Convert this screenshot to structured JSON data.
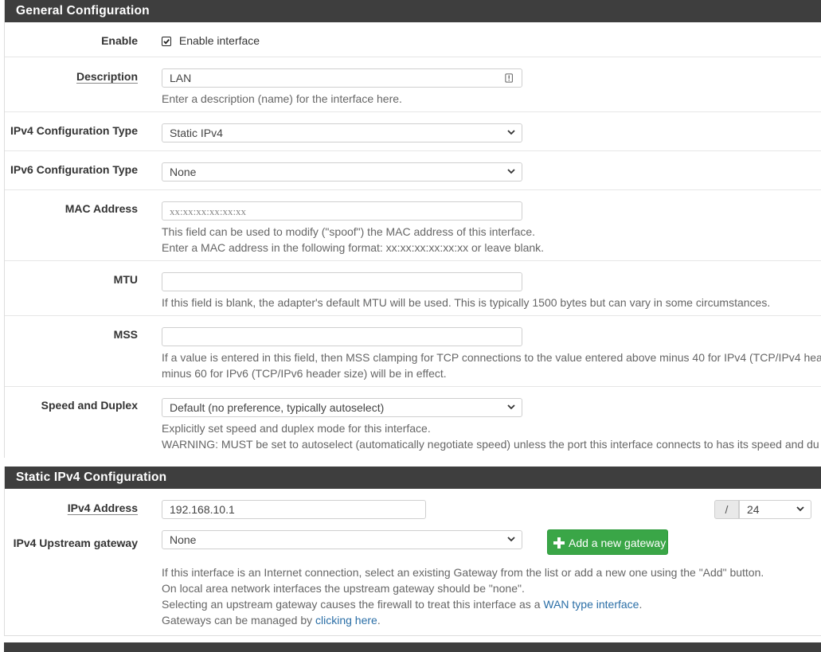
{
  "general": {
    "title": "General Configuration",
    "enable": {
      "label": "Enable",
      "checkbox_text": "Enable interface",
      "checked": true
    },
    "description": {
      "label": "Description",
      "value": "LAN",
      "help": "Enter a description (name) for the interface here."
    },
    "ipv4_type": {
      "label": "IPv4 Configuration Type",
      "value": "Static IPv4"
    },
    "ipv6_type": {
      "label": "IPv6 Configuration Type",
      "value": "None"
    },
    "mac": {
      "label": "MAC Address",
      "placeholder": "xx:xx:xx:xx:xx:xx",
      "help1": "This field can be used to modify (\"spoof\") the MAC address of this interface.",
      "help2": "Enter a MAC address in the following format: xx:xx:xx:xx:xx:xx or leave blank."
    },
    "mtu": {
      "label": "MTU",
      "value": "",
      "help": "If this field is blank, the adapter's default MTU will be used. This is typically 1500 bytes but can vary in some circumstances."
    },
    "mss": {
      "label": "MSS",
      "value": "",
      "help1": "If a value is entered in this field, then MSS clamping for TCP connections to the value entered above minus 40 for IPv4 (TCP/IPv4 hea",
      "help2": "minus 60 for IPv6 (TCP/IPv6 header size) will be in effect."
    },
    "speed": {
      "label": "Speed and Duplex",
      "value": "Default (no preference, typically autoselect)",
      "help1": "Explicitly set speed and duplex mode for this interface.",
      "help2": "WARNING: MUST be set to autoselect (automatically negotiate speed) unless the port this interface connects to has its speed and du"
    }
  },
  "static": {
    "title": "Static IPv4 Configuration",
    "address": {
      "label": "IPv4 Address",
      "value": "192.168.10.1",
      "slash": "/",
      "cidr": "24"
    },
    "gateway": {
      "label": "IPv4 Upstream gateway",
      "value": "None",
      "add_button": "Add a new gateway",
      "help1": "If this interface is an Internet connection, select an existing Gateway from the list or add a new one using the \"Add\" button.",
      "help2": "On local area network interfaces the upstream gateway should be \"none\".",
      "help3_pre": "Selecting an upstream gateway causes the firewall to treat this interface as a ",
      "help3_link": "WAN type interface",
      "help3_post": ".",
      "help4_pre": "Gateways can be managed by ",
      "help4_link": "clicking here",
      "help4_post": "."
    }
  },
  "colors": {
    "heading_bg": "#3e3e3e",
    "accent_green": "#3aa647",
    "link": "#2a6ea6"
  },
  "icons": {
    "description_field": "info-icon",
    "select": "chevron-down-icon",
    "add": "plus-icon"
  }
}
